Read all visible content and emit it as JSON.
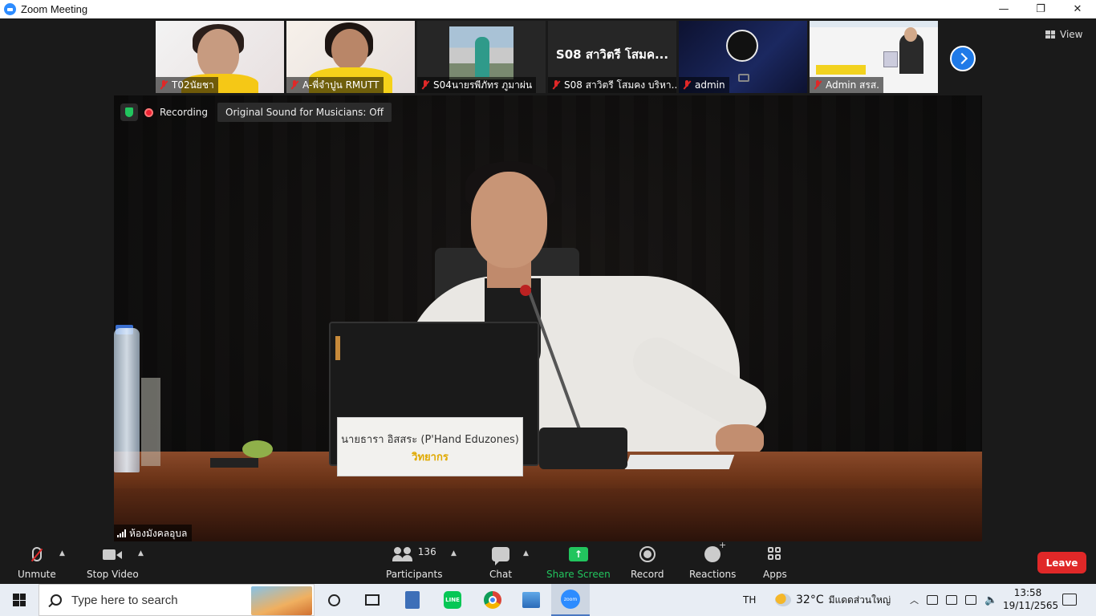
{
  "window": {
    "title": "Zoom Meeting",
    "controls": [
      "minimize",
      "maximize",
      "close"
    ]
  },
  "thumbnails": [
    {
      "label": "T02นัยชา",
      "muted": true
    },
    {
      "label": "A-พี่จำปูน RMUTT",
      "muted": true
    },
    {
      "label": "S04นายรพีภัทร ภูมาผ่น",
      "muted": true
    },
    {
      "label": "S08 สาวิตรี โสมคง บริหา...",
      "big_name": "S08 สาวิตรี โสมค...",
      "muted": true
    },
    {
      "label": "admin",
      "muted": true,
      "video_off": true
    },
    {
      "label": "Admin สรส.",
      "muted": true
    }
  ],
  "view_button": {
    "label": "View"
  },
  "main_video": {
    "recording_label": "Recording",
    "sound_chip": "Original Sound for Musicians: Off",
    "speaker_name": "ห้องมังคลอุบล",
    "nameplate_line1": "นายธารา อิสสระ (P'Hand Eduzones)",
    "nameplate_line2": "วิทยากร"
  },
  "toolbar": {
    "unmute": "Unmute",
    "stop_video": "Stop Video",
    "participants": "Participants",
    "participants_count": "136",
    "chat": "Chat",
    "share_screen": "Share Screen",
    "record": "Record",
    "reactions": "Reactions",
    "apps": "Apps",
    "leave": "Leave"
  },
  "taskbar": {
    "search_placeholder": "Type here to search",
    "input_lang": "TH",
    "temperature": "32°C",
    "weather_text": "มีแดดส่วนใหญ่",
    "time": "13:58",
    "date": "19/11/2565",
    "apps": [
      "cortana",
      "task-view",
      "calculator",
      "line",
      "chrome",
      "photos",
      "zoom"
    ]
  },
  "colors": {
    "zoom_blue": "#2d8cff",
    "share_green": "#22c55e",
    "leave_red": "#e02828",
    "muted_red": "#e02828"
  }
}
